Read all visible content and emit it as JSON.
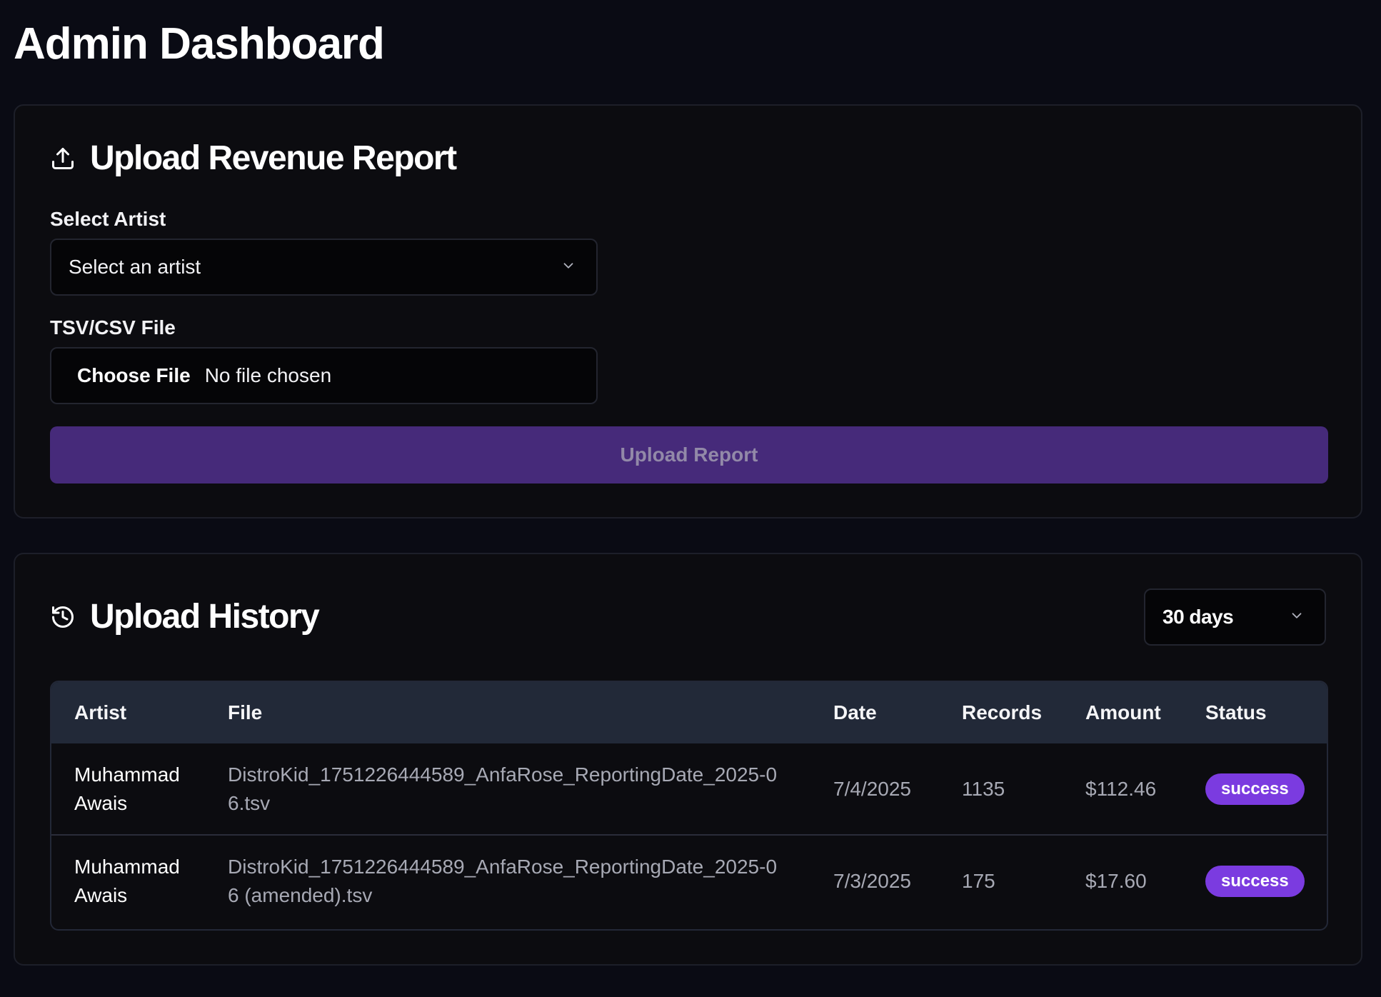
{
  "page": {
    "title": "Admin Dashboard"
  },
  "upload_card": {
    "title": "Upload Revenue Report",
    "icon": "upload-icon",
    "artist_label": "Select Artist",
    "artist_select_value": "Select an artist",
    "file_label": "TSV/CSV File",
    "file_button": "Choose File",
    "file_status": "No file chosen",
    "submit_label": "Upload Report"
  },
  "history_card": {
    "title": "Upload History",
    "icon": "history-icon",
    "range_value": "30 days",
    "columns": {
      "artist": "Artist",
      "file": "File",
      "date": "Date",
      "records": "Records",
      "amount": "Amount",
      "status": "Status"
    },
    "rows": [
      {
        "artist": "Muhammad Awais",
        "file": "DistroKid_1751226444589_AnfaRose_ReportingDate_2025-06.tsv",
        "date": "7/4/2025",
        "records": "1135",
        "amount": "$112.46",
        "status": "success"
      },
      {
        "artist": "Muhammad Awais",
        "file": "DistroKid_1751226444589_AnfaRose_ReportingDate_2025-06 (amended).tsv",
        "date": "7/3/2025",
        "records": "175",
        "amount": "$17.60",
        "status": "success"
      }
    ]
  },
  "colors": {
    "background": "#0a0b14",
    "card": "#0c0c10",
    "accent": "#7b3be0",
    "button_disabled": "#462a7a",
    "table_header": "#222938"
  }
}
